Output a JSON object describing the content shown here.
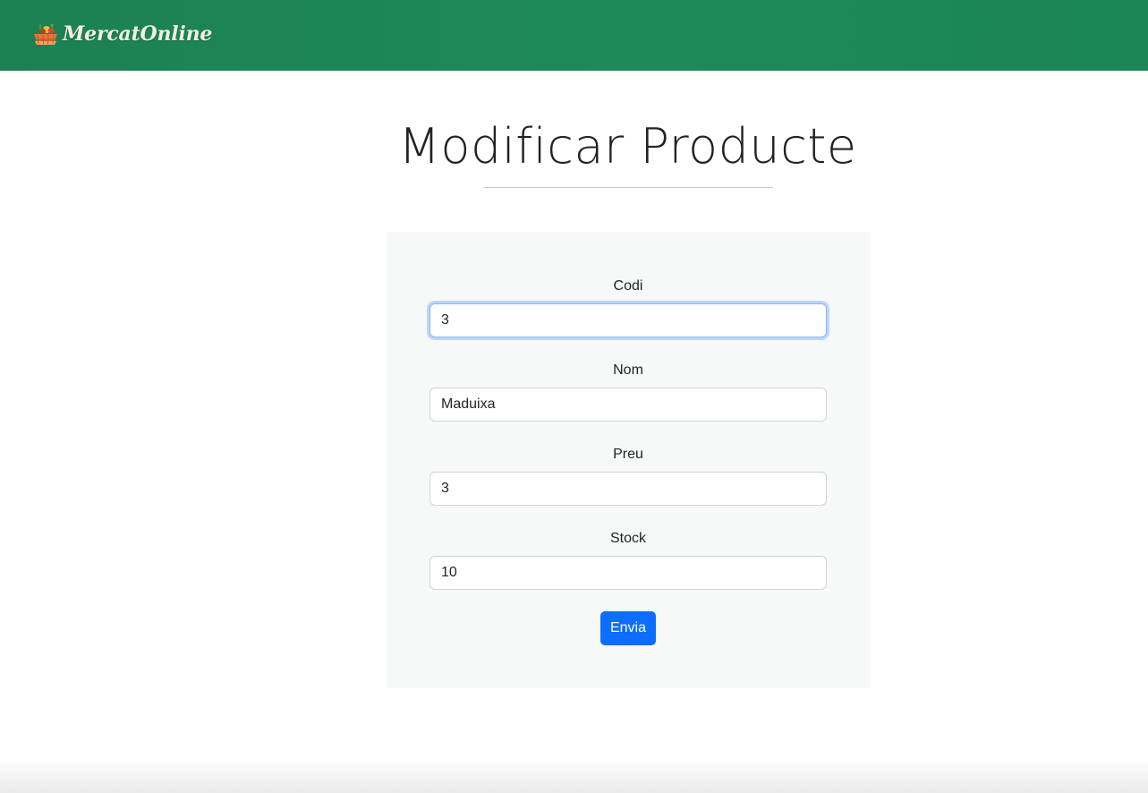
{
  "navbar": {
    "brand_name": "MercatOnline",
    "brand_icon": "produce-basket-icon",
    "background_color": "#1b8655"
  },
  "page": {
    "title": "Modificar Producte"
  },
  "form": {
    "fields": [
      {
        "label": "Codi",
        "value": "3"
      },
      {
        "label": "Nom",
        "value": "Maduixa"
      },
      {
        "label": "Preu",
        "value": "3"
      },
      {
        "label": "Stock",
        "value": "10"
      }
    ],
    "submit_label": "Envia",
    "submit_color": "#0d6efd"
  }
}
